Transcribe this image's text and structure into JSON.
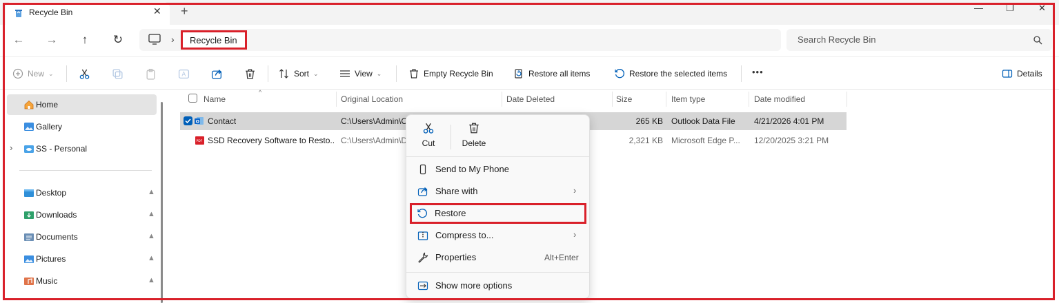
{
  "colors": {
    "accent": "#005fb8",
    "highlight": "#d9202a",
    "selection": "#d6d6d6"
  },
  "tab": {
    "title": "Recycle Bin",
    "close": "✕",
    "new_tab": "+"
  },
  "window": {
    "minimize": "—",
    "maximize": "❐",
    "close": "✕"
  },
  "nav": {
    "back": "←",
    "forward": "→",
    "up": "↑",
    "refresh": "↻",
    "separator": "›"
  },
  "address": {
    "crumb": "Recycle Bin"
  },
  "search": {
    "placeholder": "Search Recycle Bin"
  },
  "toolbar": {
    "new": "New",
    "sort": "Sort",
    "view": "View",
    "empty": "Empty Recycle Bin",
    "restore_all": "Restore all items",
    "restore_selected": "Restore the selected items",
    "more": "•••",
    "details": "Details"
  },
  "sidebar": {
    "items": [
      {
        "label": "Home"
      },
      {
        "label": "Gallery"
      },
      {
        "label": "SS - Personal"
      },
      {
        "label": "Desktop"
      },
      {
        "label": "Downloads"
      },
      {
        "label": "Documents"
      },
      {
        "label": "Pictures"
      },
      {
        "label": "Music"
      }
    ],
    "expander": "›",
    "pin": "📌"
  },
  "columns": {
    "name": "Name",
    "original_location": "Original Location",
    "date_deleted": "Date Deleted",
    "size": "Size",
    "item_type": "Item type",
    "date_modified": "Date modified"
  },
  "files": [
    {
      "name": "Contact",
      "location": "C:\\Users\\Admin\\C",
      "size": "265 KB",
      "type": "Outlook Data File",
      "modified": "4/21/2026 4:01 PM"
    },
    {
      "name": "SSD Recovery Software to Resto...",
      "location": "C:\\Users\\Admin\\D",
      "size": "2,321 KB",
      "type": "Microsoft Edge P...",
      "modified": "12/20/2025 3:21 PM"
    }
  ],
  "context_menu": {
    "cut": "Cut",
    "delete": "Delete",
    "send_to_phone": "Send to My Phone",
    "share_with": "Share with",
    "restore": "Restore",
    "compress": "Compress to...",
    "properties": "Properties",
    "properties_shortcut": "Alt+Enter",
    "show_more": "Show more options",
    "submenu_arrow": "›"
  }
}
